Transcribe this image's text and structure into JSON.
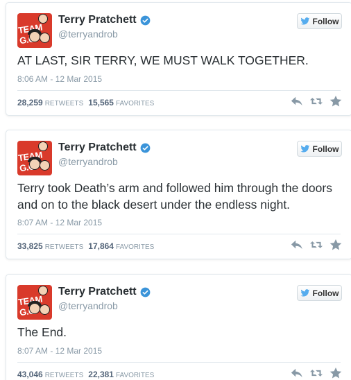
{
  "colors": {
    "verified": "#3b94d9",
    "follow_bird": "#55acee",
    "handle": "#8899a6",
    "border": "#e1e8ed",
    "avatar_bg": "#d93a2b"
  },
  "icons": {
    "verified": "verified-badge-icon",
    "follow": "twitter-bird-icon",
    "reply": "reply-icon",
    "retweet": "retweet-icon",
    "favorite": "star-icon"
  },
  "tweets": [
    {
      "avatar_text": "TEAM G.O.",
      "name": "Terry Pratchett",
      "handle": "@terryandrob",
      "follow_label": "Follow",
      "text": "AT LAST, SIR TERRY, WE MUST WALK TOGETHER.",
      "time": "8:06 AM - 12 Mar 2015",
      "retweets": "28,259",
      "retweets_label": "RETWEETS",
      "favorites": "15,565",
      "favorites_label": "FAVORITES"
    },
    {
      "avatar_text": "TEAM G.O.",
      "name": "Terry Pratchett",
      "handle": "@terryandrob",
      "follow_label": "Follow",
      "text": "Terry took Death’s arm and followed him through the doors and on to the black desert under the endless night.",
      "time": "8:07 AM - 12 Mar 2015",
      "retweets": "33,825",
      "retweets_label": "RETWEETS",
      "favorites": "17,864",
      "favorites_label": "FAVORITES"
    },
    {
      "avatar_text": "TEAM G.O.",
      "name": "Terry Pratchett",
      "handle": "@terryandrob",
      "follow_label": "Follow",
      "text": "The End.",
      "time": "8:07 AM - 12 Mar 2015",
      "retweets": "43,046",
      "retweets_label": "RETWEETS",
      "favorites": "22,381",
      "favorites_label": "FAVORITES"
    }
  ]
}
